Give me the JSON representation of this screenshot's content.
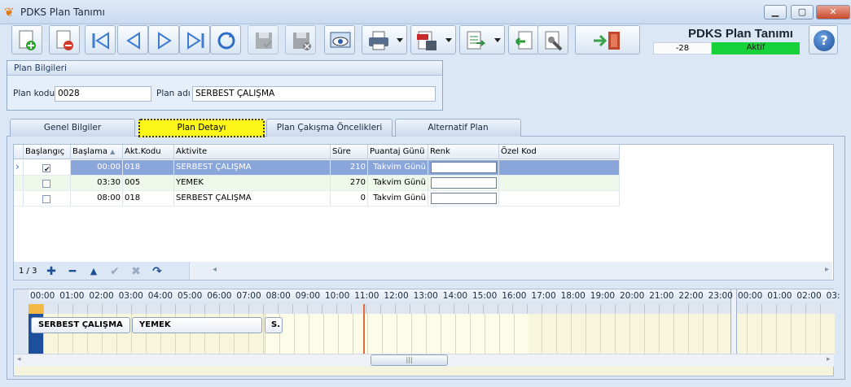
{
  "window": {
    "title": "PDKS Plan Tanımı",
    "min": "▁",
    "max": "▢",
    "close": "✕"
  },
  "header": {
    "title": "PDKS Plan Tanımı",
    "counter": "-28",
    "status": "Aktif"
  },
  "toolbar": {
    "icons": [
      "new-icon",
      "delete-icon",
      "first-icon",
      "prev-icon",
      "next-icon",
      "last-icon",
      "refresh-icon",
      "save-icon",
      "cancel-save-icon",
      "preview-icon",
      "print-icon",
      "pdf-export-icon",
      "excel-export-icon",
      "import-icon",
      "settings-icon",
      "exit-icon",
      "help-icon"
    ]
  },
  "plan_info": {
    "title": "Plan Bilgileri",
    "code_label": "Plan kodu",
    "code": "0028",
    "name_label": "Plan adı",
    "name": "SERBEST ÇALIŞMA"
  },
  "tabs": [
    "Genel Bilgiler",
    "Plan Detayı",
    "Plan Çakışma Öncelikleri",
    "Alternatif Plan"
  ],
  "grid": {
    "columns": [
      "Başlangıç",
      "Başlama",
      "Akt.Kodu",
      "Aktivite",
      "Süre",
      "Puantaj Günü",
      "Renk",
      "Özel Kod"
    ],
    "rows": [
      {
        "start": true,
        "time": "00:00",
        "code": "018",
        "activity": "SERBEST ÇALIŞMA",
        "duration": "210",
        "day": "Takvim Günü"
      },
      {
        "start": false,
        "time": "03:30",
        "code": "005",
        "activity": "YEMEK",
        "duration": "270",
        "day": "Takvim Günü"
      },
      {
        "start": false,
        "time": "08:00",
        "code": "018",
        "activity": "SERBEST ÇALIŞMA",
        "duration": "0",
        "day": "Takvim Günü"
      }
    ],
    "nav_count": "1 / 3",
    "nav_icons": [
      "add-icon",
      "remove-icon",
      "up-icon",
      "confirm-icon",
      "cancel-icon",
      "redo-icon"
    ]
  },
  "timeline": {
    "hours": [
      "00:00",
      "01:00",
      "02:00",
      "03:00",
      "04:00",
      "05:00",
      "06:00",
      "07:00",
      "08:00",
      "09:00",
      "10:00",
      "11:00",
      "12:00",
      "13:00",
      "14:00",
      "15:00",
      "16:00",
      "17:00",
      "18:00",
      "19:00",
      "20:00",
      "21:00",
      "22:00",
      "23:00"
    ],
    "hours2": [
      "00:00",
      "01:00",
      "02:00",
      "03:"
    ],
    "appointments": [
      "SERBEST ÇALIŞMA",
      "YEMEK",
      "S."
    ],
    "thumb": "|||"
  }
}
